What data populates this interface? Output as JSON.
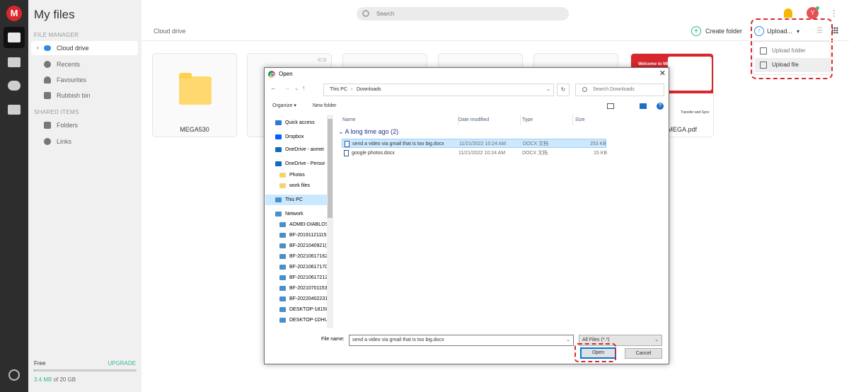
{
  "app": {
    "logo_letter": "M",
    "accent": "#d9272e",
    "green": "#34b89c"
  },
  "rail": {
    "icons": [
      "cloud-drive-icon",
      "photos-icon",
      "chat-icon",
      "devices-icon",
      "settings-icon"
    ]
  },
  "sidebar": {
    "title": "My files",
    "section_file_manager": "FILE MANAGER",
    "items": [
      {
        "label": "Cloud drive",
        "icon": "cloud-icon"
      },
      {
        "label": "Recents",
        "icon": "clock-icon"
      },
      {
        "label": "Favourites",
        "icon": "heart-icon"
      },
      {
        "label": "Rubbish bin",
        "icon": "trash-icon"
      }
    ],
    "section_shared": "SHARED ITEMS",
    "shared_items": [
      {
        "label": "Folders",
        "icon": "shared-folder-icon"
      },
      {
        "label": "Links",
        "icon": "link-icon"
      }
    ],
    "plan": "Free",
    "upgrade": "UPGRADE",
    "usage_used": "3.4 MB",
    "usage_rest": " of 20 GB",
    "usage_fraction": 0.00017
  },
  "header": {
    "search_placeholder": "Search",
    "avatar_letter": "Y"
  },
  "toolbar": {
    "breadcrumb": "Cloud drive",
    "create_folder": "Create folder",
    "upload": "Upload...",
    "upload_menu": [
      "Upload folder",
      "Upload file"
    ]
  },
  "files": {
    "folder_name": "MEGA530",
    "pdf_name": "o MEGA.pdf",
    "pdf_thumb_title": "Welcome to MEGA",
    "pdf_thumb_caption": "Transfer and Sync"
  },
  "dialog": {
    "title": "Open",
    "path": [
      "This PC",
      "Downloads"
    ],
    "search_placeholder": "Search Downloads",
    "organize": "Organize ▾",
    "new_folder": "New folder",
    "nav_items": [
      {
        "label": "Quick access",
        "icon": "star-icon",
        "color": "#2d7ad6"
      },
      {
        "label": "Dropbox",
        "icon": "dropbox-icon",
        "color": "#0061fe"
      },
      {
        "label": "OneDrive - aomei",
        "icon": "onedrive-icon",
        "color": "#0f6cbd"
      },
      {
        "label": "OneDrive - Persor",
        "icon": "onedrive-icon",
        "color": "#0f6cbd"
      },
      {
        "label": "Photos",
        "icon": "folder-icon",
        "color": "#f7d46b"
      },
      {
        "label": "work files",
        "icon": "folder-icon",
        "color": "#f7d46b"
      },
      {
        "label": "This PC",
        "icon": "pc-icon",
        "color": "#4a90c8"
      },
      {
        "label": "Network",
        "icon": "network-icon",
        "color": "#4a90c8"
      },
      {
        "label": "AOMEI-DIABLOS",
        "icon": "computer-icon",
        "color": "#4a90c8"
      },
      {
        "label": "BF-20191121115",
        "icon": "computer-icon",
        "color": "#4a90c8"
      },
      {
        "label": "BF-2021040921(",
        "icon": "computer-icon",
        "color": "#4a90c8"
      },
      {
        "label": "BF-20210617162",
        "icon": "computer-icon",
        "color": "#4a90c8"
      },
      {
        "label": "BF-20210617170",
        "icon": "computer-icon",
        "color": "#4a90c8"
      },
      {
        "label": "BF-20210617212",
        "icon": "computer-icon",
        "color": "#4a90c8"
      },
      {
        "label": "BF-20210701153",
        "icon": "computer-icon",
        "color": "#4a90c8"
      },
      {
        "label": "BF-202204022314",
        "icon": "computer-icon",
        "color": "#4a90c8"
      },
      {
        "label": "DESKTOP-1815IK",
        "icon": "computer-icon",
        "color": "#4a90c8"
      },
      {
        "label": "DESKTOP-1DHUC",
        "icon": "computer-icon",
        "color": "#4a90c8"
      }
    ],
    "columns": [
      "Name",
      "Date modified",
      "Type",
      "Size"
    ],
    "group": "A long time ago (2)",
    "rows": [
      {
        "name": "send a video via gmail that is too big.docx",
        "date": "11/21/2022 10:24 AM",
        "type": "DOCX 文档",
        "size": "253 KB"
      },
      {
        "name": "google photos.docx",
        "date": "11/21/2022 10:24 AM",
        "type": "DOCX 文档",
        "size": "15 KB"
      }
    ],
    "file_name_label": "File name:",
    "file_name_value": "send a video via gmail that is too big.docx",
    "file_type": "All Files (*.*)",
    "open_label": "Open",
    "cancel_label": "Cancel"
  }
}
